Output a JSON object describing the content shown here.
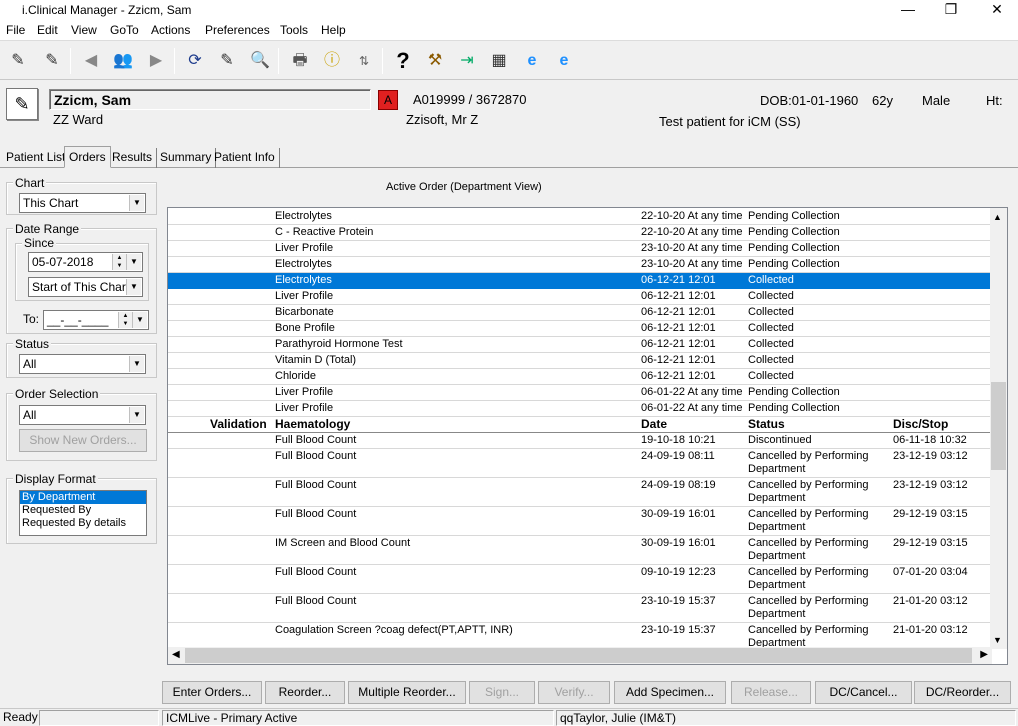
{
  "window": {
    "title": "i.Clinical Manager - Zzicm, Sam",
    "min": "—",
    "max": "❐",
    "close": "✕"
  },
  "menu": [
    "File",
    "Edit",
    "View",
    "GoTo",
    "Actions",
    "Preferences",
    "Tools",
    "Help"
  ],
  "patient": {
    "name": "Zzicm, Sam",
    "ward": "ZZ Ward",
    "alert": "A",
    "ids": "A019999 / 3672870",
    "consultant": "Zzisoft, Mr Z",
    "dob": "DOB:01-01-1960",
    "age": "62y",
    "sex": "Male",
    "ht": "Ht:",
    "note": "Test patient for iCM (SS)"
  },
  "tabs": [
    "Patient List",
    "Orders",
    "Results",
    "Summary",
    "Patient Info"
  ],
  "left": {
    "chart_label": "Chart",
    "chart_value": "This Chart",
    "date_range_label": "Date Range",
    "since_label": "Since",
    "since_date": "05-07-2018",
    "since_mode": "Start of This Chart",
    "to_label": "To:",
    "to_value": "__-__-____",
    "status_label": "Status",
    "status_value": "All",
    "order_sel_label": "Order Selection",
    "order_sel_value": "All",
    "show_new": "Show New Orders...",
    "display_label": "Display Format",
    "display_options": [
      "By Department",
      "Requested By",
      "Requested By details"
    ]
  },
  "grid": {
    "title": "Active Order (Department View)",
    "rows_top": [
      {
        "name": "Electrolytes",
        "date": "22-10-20 At any time",
        "status": "Pending Collection"
      },
      {
        "name": "C - Reactive Protein",
        "date": "22-10-20 At any time",
        "status": "Pending Collection"
      },
      {
        "name": "Liver Profile",
        "date": "23-10-20 At any time",
        "status": "Pending Collection"
      },
      {
        "name": "Electrolytes",
        "date": "23-10-20 At any time",
        "status": "Pending Collection"
      },
      {
        "name": "Electrolytes",
        "date": "06-12-21 12:01",
        "status": "Collected"
      },
      {
        "name": "Liver Profile",
        "date": "06-12-21 12:01",
        "status": "Collected"
      },
      {
        "name": "Bicarbonate",
        "date": "06-12-21 12:01",
        "status": "Collected"
      },
      {
        "name": "Bone Profile",
        "date": "06-12-21 12:01",
        "status": "Collected"
      },
      {
        "name": "Parathyroid Hormone Test",
        "date": "06-12-21 12:01",
        "status": "Collected"
      },
      {
        "name": "Vitamin D (Total)",
        "date": "06-12-21 12:01",
        "status": "Collected"
      },
      {
        "name": "Chloride",
        "date": "06-12-21 12:01",
        "status": "Collected"
      },
      {
        "name": "Liver Profile",
        "date": "06-01-22 At any time",
        "status": "Pending Collection"
      },
      {
        "name": "Liver Profile",
        "date": "06-01-22 At any time",
        "status": "Pending Collection"
      }
    ],
    "header": {
      "validation": "Validation",
      "dept": "Haematology",
      "date": "Date",
      "status": "Status",
      "stop": "Disc/Stop"
    },
    "rows_haem": [
      {
        "name": "Full Blood Count",
        "date": "19-10-18 10:21",
        "status1": "Discontinued",
        "status2": "",
        "stop": "06-11-18 10:32"
      },
      {
        "name": "Full Blood Count",
        "date": "24-09-19 08:11",
        "status1": "Cancelled by Performing",
        "status2": "Department",
        "stop": "23-12-19 03:12"
      },
      {
        "name": "Full Blood Count",
        "date": "24-09-19 08:19",
        "status1": "Cancelled by Performing",
        "status2": "Department",
        "stop": "23-12-19 03:12"
      },
      {
        "name": "Full Blood Count",
        "date": "30-09-19 16:01",
        "status1": "Cancelled by Performing",
        "status2": "Department",
        "stop": "29-12-19 03:15"
      },
      {
        "name": "IM Screen and Blood Count",
        "date": "30-09-19 16:01",
        "status1": "Cancelled by Performing",
        "status2": "Department",
        "stop": "29-12-19 03:15"
      },
      {
        "name": "Full Blood Count",
        "date": "09-10-19 12:23",
        "status1": "Cancelled by Performing",
        "status2": "Department",
        "stop": "07-01-20 03:04"
      },
      {
        "name": "Full Blood Count",
        "date": "23-10-19 15:37",
        "status1": "Cancelled by Performing",
        "status2": "Department",
        "stop": "21-01-20 03:12"
      },
      {
        "name": "Coagulation Screen ?coag defect(PT,APTT, INR)",
        "date": "23-10-19 15:37",
        "status1": "Cancelled by Performing",
        "status2": "Department",
        "stop": "21-01-20 03:12"
      }
    ]
  },
  "buttons": [
    "Enter Orders...",
    "Reorder...",
    "Multiple Reorder...",
    "Sign...",
    "Verify...",
    "Add Specimen...",
    "Release...",
    "DC/Cancel...",
    "DC/Reorder..."
  ],
  "status": {
    "ready": "Ready",
    "env": "ICMLive - Primary Active",
    "user": "qqTaylor, Julie (IM&T)"
  }
}
